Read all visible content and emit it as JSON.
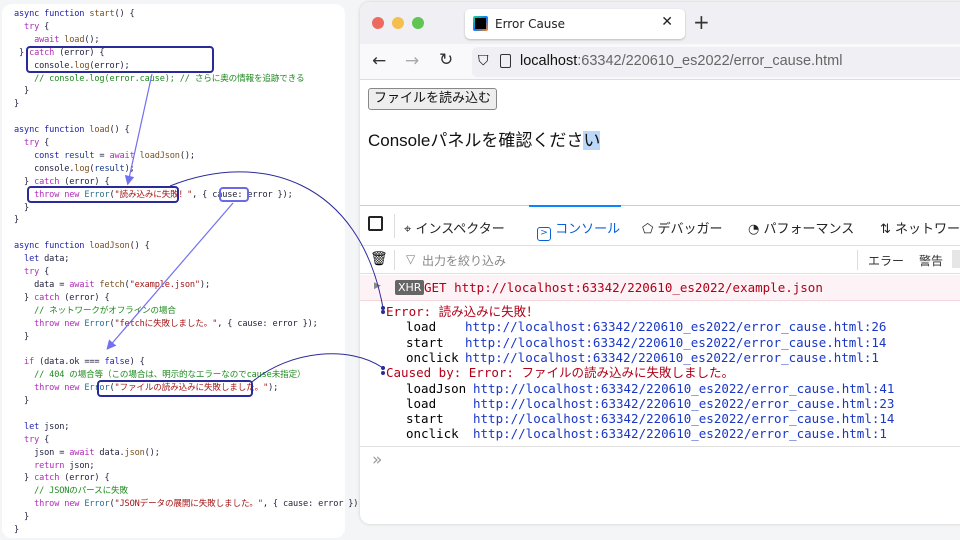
{
  "code": [
    [
      [
        "kw",
        "async function "
      ],
      [
        "fn",
        "start"
      ],
      [
        "",
        "() {"
      ]
    ],
    [
      [
        "ctl",
        "  try"
      ],
      [
        "",
        " {"
      ]
    ],
    [
      [
        "ctl",
        "    await "
      ],
      [
        "fn",
        "load"
      ],
      [
        "",
        "();"
      ]
    ],
    [
      [
        "",
        " } "
      ],
      [
        "ctl",
        "catch"
      ],
      [
        "",
        " (error) {"
      ]
    ],
    [
      [
        "",
        "    console."
      ],
      [
        "fn",
        "log"
      ],
      [
        "",
        "(error);"
      ]
    ],
    [
      [
        "cm",
        "    // console.log(error.cause); // さらに奥の情報を追跡できる"
      ]
    ],
    [
      [
        "",
        "  }"
      ]
    ],
    [
      [
        "",
        "}"
      ]
    ],
    [],
    [
      [
        "kw",
        "async function "
      ],
      [
        "fn",
        "load"
      ],
      [
        "",
        "() {"
      ]
    ],
    [
      [
        "ctl",
        "  try"
      ],
      [
        "",
        " {"
      ]
    ],
    [
      [
        "kw",
        "    const "
      ],
      [
        "var",
        "result"
      ],
      [
        "",
        " = "
      ],
      [
        "ctl",
        "await "
      ],
      [
        "fn",
        "loadJson"
      ],
      [
        "",
        "();"
      ]
    ],
    [
      [
        "",
        "    console."
      ],
      [
        "fn",
        "log"
      ],
      [
        "",
        "("
      ],
      [
        "var",
        "result"
      ],
      [
        "",
        "); "
      ]
    ],
    [
      [
        "",
        "  } "
      ],
      [
        "ctl",
        "catch"
      ],
      [
        "",
        " (error) {"
      ]
    ],
    [
      [
        "ctl",
        "    throw new "
      ],
      [
        "cls",
        "Error"
      ],
      [
        "",
        "("
      ],
      [
        "str",
        "\"読み込みに失敗！\""
      ],
      [
        "",
        ", { cause: error });"
      ]
    ],
    [
      [
        "",
        "  }"
      ]
    ],
    [
      [
        "",
        "}"
      ]
    ],
    [],
    [
      [
        "kw",
        "async function "
      ],
      [
        "fn",
        "loadJson"
      ],
      [
        "",
        "() {"
      ]
    ],
    [
      [
        "kw",
        "  let "
      ],
      [
        "",
        "data;"
      ]
    ],
    [
      [
        "ctl",
        "  try"
      ],
      [
        "",
        " {"
      ]
    ],
    [
      [
        "",
        "    data = "
      ],
      [
        "ctl",
        "await "
      ],
      [
        "fn",
        "fetch"
      ],
      [
        "",
        "("
      ],
      [
        "str",
        "\"example.json\""
      ],
      [
        "",
        ");"
      ]
    ],
    [
      [
        "",
        "  } "
      ],
      [
        "ctl",
        "catch"
      ],
      [
        "",
        " (error) {"
      ]
    ],
    [
      [
        "cm",
        "    // ネットワークがオフラインの場合"
      ]
    ],
    [
      [
        "ctl",
        "    throw new "
      ],
      [
        "cls",
        "Error"
      ],
      [
        "",
        "("
      ],
      [
        "str",
        "\"fetchに失敗しました。\""
      ],
      [
        "",
        ", { cause: error });"
      ]
    ],
    [
      [
        "",
        "  }"
      ]
    ],
    [],
    [
      [
        "ctl",
        "  if"
      ],
      [
        "",
        " (data.ok === "
      ],
      [
        "lit",
        "false"
      ],
      [
        "",
        ") {"
      ]
    ],
    [
      [
        "cm",
        "    // 404 の場合等（この場合は、明示的なエラーなのでcause未指定）"
      ]
    ],
    [
      [
        "ctl",
        "    throw new "
      ],
      [
        "cls",
        "Error"
      ],
      [
        "",
        "("
      ],
      [
        "str",
        "\"ファイルの読み込みに失敗しました。\""
      ],
      [
        "",
        ");"
      ]
    ],
    [
      [
        "",
        "  }"
      ]
    ],
    [],
    [
      [
        "kw",
        "  let "
      ],
      [
        "",
        "json;"
      ]
    ],
    [
      [
        "ctl",
        "  try"
      ],
      [
        "",
        " {"
      ]
    ],
    [
      [
        "",
        "    json = "
      ],
      [
        "ctl",
        "await "
      ],
      [
        "",
        "data."
      ],
      [
        "fn",
        "json"
      ],
      [
        "",
        "();"
      ]
    ],
    [
      [
        "ctl",
        "    return "
      ],
      [
        "",
        "json;"
      ]
    ],
    [
      [
        "",
        "  } "
      ],
      [
        "ctl",
        "catch"
      ],
      [
        "",
        " (error) {"
      ]
    ],
    [
      [
        "cm",
        "    // JSONのパースに失敗"
      ]
    ],
    [
      [
        "ctl",
        "    throw new "
      ],
      [
        "cls",
        "Error"
      ],
      [
        "",
        "("
      ],
      [
        "str",
        "\"JSONデータの展開に失敗しました。\""
      ],
      [
        "",
        ", { cause: error });"
      ]
    ],
    [
      [
        "",
        "  }"
      ]
    ],
    [
      [
        "",
        "}"
      ]
    ]
  ],
  "browser": {
    "tab_title": "Error Cause",
    "url_host": "localhost",
    "url_path": ":63342/220610_es2022/error_cause.html",
    "page_button": "ファイルを読み込む",
    "page_text": "Consoleパネルを確認くださ",
    "page_text_selected": "い"
  },
  "devtools": {
    "tabs": [
      "インスペクター",
      "コンソール",
      "デバッガー",
      "パフォーマンス",
      "ネットワーク"
    ],
    "active_tab": "コンソール",
    "filter_placeholder": "出力を絞り込み",
    "levels": [
      "エラー",
      "警告"
    ],
    "xhr_badge": "XHR",
    "xhr_line": "GET http://localhost:63342/220610_es2022/example.json",
    "error_msg": "Error: 読み込みに失敗！",
    "error_stack": [
      [
        "load",
        "http://localhost:63342/220610_es2022/error_cause.html:26"
      ],
      [
        "start",
        "http://localhost:63342/220610_es2022/error_cause.html:14"
      ],
      [
        "onclick",
        "http://localhost:63342/220610_es2022/error_cause.html:1"
      ]
    ],
    "cause_msg": "Caused by: Error: ファイルの読み込みに失敗しました。",
    "cause_stack": [
      [
        "loadJson",
        "http://localhost:63342/220610_es2022/error_cause.html:41"
      ],
      [
        "load",
        "http://localhost:63342/220610_es2022/error_cause.html:23"
      ],
      [
        "start",
        "http://localhost:63342/220610_es2022/error_cause.html:14"
      ],
      [
        "onclick",
        "http://localhost:63342/220610_es2022/error_cause.html:1"
      ]
    ],
    "prompt": "»"
  },
  "colors": {
    "highlight": "#2a2a9a",
    "arrow": "#7070f0"
  }
}
